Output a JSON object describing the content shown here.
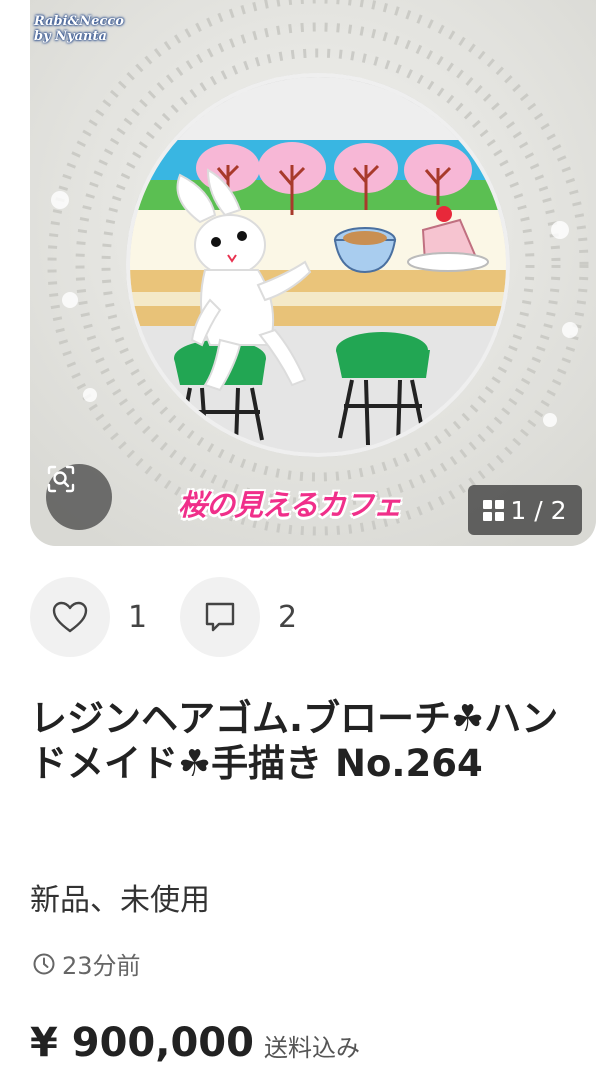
{
  "photo": {
    "watermark_line1": "Rabi&Necco",
    "watermark_line2": "by Nyanta",
    "caption": "桜の見えるカフェ",
    "counter": "1 / 2",
    "zoom_icon": "zoom-scan-icon"
  },
  "actions": {
    "like_count": "1",
    "comment_count": "2",
    "like_icon": "heart-icon",
    "comment_icon": "comment-icon"
  },
  "item": {
    "title": "レジンヘアゴム.ブローチ☘ハンドメイド☘手描き No.264",
    "condition": "新品、未使用",
    "posted": "23分前",
    "price": "¥ 900,000",
    "shipping": "送料込み"
  }
}
